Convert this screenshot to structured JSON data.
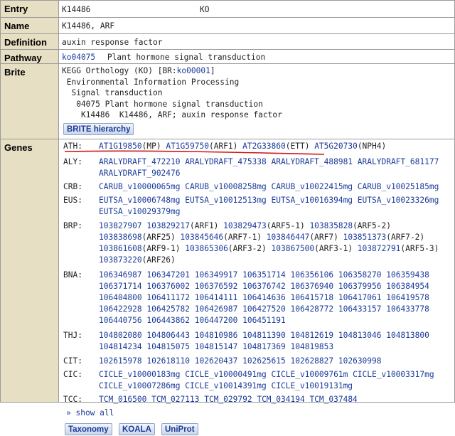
{
  "entry": {
    "label": "Entry",
    "id": "K14486",
    "type": "KO"
  },
  "name": {
    "label": "Name",
    "value": "K14486, ARF"
  },
  "definition": {
    "label": "Definition",
    "value": "auxin response factor"
  },
  "pathway": {
    "label": "Pathway",
    "id": "ko04075",
    "desc": "Plant hormone signal transduction"
  },
  "brite": {
    "label": "Brite",
    "lines": [
      {
        "pre": "KEGG Orthology (KO) [BR:",
        "link": "ko00001",
        "post": "]"
      },
      {
        "pre": " Environmental Information Processing",
        "link": "",
        "post": ""
      },
      {
        "pre": "  Signal transduction",
        "link": "",
        "post": ""
      },
      {
        "pre": "   04075 Plant hormone signal transduction",
        "link": "",
        "post": ""
      },
      {
        "pre": "    K14486  K14486, ARF; auxin response factor",
        "link": "",
        "post": ""
      }
    ],
    "button": "BRITE hierarchy"
  },
  "genes": {
    "label": "Genes",
    "organisms": [
      {
        "code": "ATH:",
        "lines": [
          [
            [
              "AT1G19850",
              "(MP)"
            ],
            [
              "AT1G59750",
              "(ARF1)"
            ],
            [
              "AT2G33860",
              "(ETT)"
            ],
            [
              "AT5G20730",
              "(NPH4)"
            ]
          ]
        ]
      },
      {
        "code": "ALY:",
        "lines": [
          [
            [
              "ARALYDRAFT_472210",
              ""
            ],
            [
              "ARALYDRAFT_475338",
              ""
            ],
            [
              "ARALYDRAFT_488981",
              ""
            ],
            [
              "ARALYDRAFT_681177",
              ""
            ]
          ],
          [
            [
              "ARALYDRAFT_902476",
              ""
            ]
          ]
        ]
      },
      {
        "code": "CRB:",
        "lines": [
          [
            [
              "CARUB_v10000065mg",
              ""
            ],
            [
              "CARUB_v10008258mg",
              ""
            ],
            [
              "CARUB_v10022415mg",
              ""
            ],
            [
              "CARUB_v10025185mg",
              ""
            ]
          ]
        ]
      },
      {
        "code": "EUS:",
        "lines": [
          [
            [
              "EUTSA_v10006748mg",
              ""
            ],
            [
              "EUTSA_v10012513mg",
              ""
            ],
            [
              "EUTSA_v10016394mg",
              ""
            ],
            [
              "EUTSA_v10023326mg",
              ""
            ]
          ],
          [
            [
              "EUTSA_v10029379mg",
              ""
            ]
          ]
        ]
      },
      {
        "code": "BRP:",
        "lines": [
          [
            [
              "103827907",
              ""
            ],
            [
              "103829217",
              "(ARF1)"
            ],
            [
              "103829473",
              "(ARF5-1)"
            ],
            [
              "103835828",
              "(ARF5-2)"
            ]
          ],
          [
            [
              "103838698",
              "(ARF25)"
            ],
            [
              "103845646",
              "(ARF7-1)"
            ],
            [
              "103846447",
              "(ARF7)"
            ],
            [
              "103851373",
              "(ARF7-2)"
            ]
          ],
          [
            [
              "103861608",
              "(ARF9-1)"
            ],
            [
              "103865306",
              "(ARF3-2)"
            ],
            [
              "103867500",
              "(ARF3-1)"
            ],
            [
              "103872791",
              "(ARF5-3)"
            ]
          ],
          [
            [
              "103873220",
              "(ARF26)"
            ]
          ]
        ]
      },
      {
        "code": "BNA:",
        "lines": [
          [
            [
              "106346987",
              ""
            ],
            [
              "106347201",
              ""
            ],
            [
              "106349917",
              ""
            ],
            [
              "106351714",
              ""
            ],
            [
              "106356106",
              ""
            ],
            [
              "106358270",
              ""
            ],
            [
              "106359438",
              ""
            ]
          ],
          [
            [
              "106371714",
              ""
            ],
            [
              "106376002",
              ""
            ],
            [
              "106376592",
              ""
            ],
            [
              "106376742",
              ""
            ],
            [
              "106376940",
              ""
            ],
            [
              "106379956",
              ""
            ],
            [
              "106384954",
              ""
            ]
          ],
          [
            [
              "106404800",
              ""
            ],
            [
              "106411172",
              ""
            ],
            [
              "106414111",
              ""
            ],
            [
              "106414636",
              ""
            ],
            [
              "106415718",
              ""
            ],
            [
              "106417061",
              ""
            ],
            [
              "106419578",
              ""
            ]
          ],
          [
            [
              "106422928",
              ""
            ],
            [
              "106425782",
              ""
            ],
            [
              "106426987",
              ""
            ],
            [
              "106427520",
              ""
            ],
            [
              "106428772",
              ""
            ],
            [
              "106433157",
              ""
            ],
            [
              "106433778",
              ""
            ]
          ],
          [
            [
              "106440756",
              ""
            ],
            [
              "106443862",
              ""
            ],
            [
              "106447200",
              ""
            ],
            [
              "106451191",
              ""
            ]
          ]
        ]
      },
      {
        "code": "THJ:",
        "lines": [
          [
            [
              "104802080",
              ""
            ],
            [
              "104806443",
              ""
            ],
            [
              "104810986",
              ""
            ],
            [
              "104811390",
              ""
            ],
            [
              "104812619",
              ""
            ],
            [
              "104813046",
              ""
            ],
            [
              "104813800",
              ""
            ]
          ],
          [
            [
              "104814234",
              ""
            ],
            [
              "104815075",
              ""
            ],
            [
              "104815147",
              ""
            ],
            [
              "104817369",
              ""
            ],
            [
              "104819853",
              ""
            ]
          ]
        ]
      },
      {
        "code": "CIT:",
        "lines": [
          [
            [
              "102615978",
              ""
            ],
            [
              "102618110",
              ""
            ],
            [
              "102620437",
              ""
            ],
            [
              "102625615",
              ""
            ],
            [
              "102628827",
              ""
            ],
            [
              "102630998",
              ""
            ]
          ]
        ]
      },
      {
        "code": "CIC:",
        "lines": [
          [
            [
              "CICLE_v10000183mg",
              ""
            ],
            [
              "CICLE_v10000491mg",
              ""
            ],
            [
              "CICLE_v10009761m",
              ""
            ],
            [
              "CICLE_v10003317mg",
              ""
            ]
          ],
          [
            [
              "CICLE_v10007286mg",
              ""
            ],
            [
              "CICLE_v10014391mg",
              ""
            ],
            [
              "CICLE_v10019131mg",
              ""
            ]
          ]
        ]
      },
      {
        "code": "TCC:",
        "lines": [
          [
            [
              "TCM_016500",
              ""
            ],
            [
              "TCM_027113",
              ""
            ],
            [
              "TCM_029792",
              ""
            ],
            [
              "TCM_034194",
              ""
            ],
            [
              "TCM_037484",
              ""
            ]
          ]
        ]
      }
    ],
    "show_all": "» show all",
    "buttons": [
      "Taxonomy",
      "KOALA",
      "UniProt"
    ]
  },
  "colors": {
    "label_bg": "#e7dfc3",
    "link": "#1a3b9a",
    "annotation": "#d01818"
  }
}
